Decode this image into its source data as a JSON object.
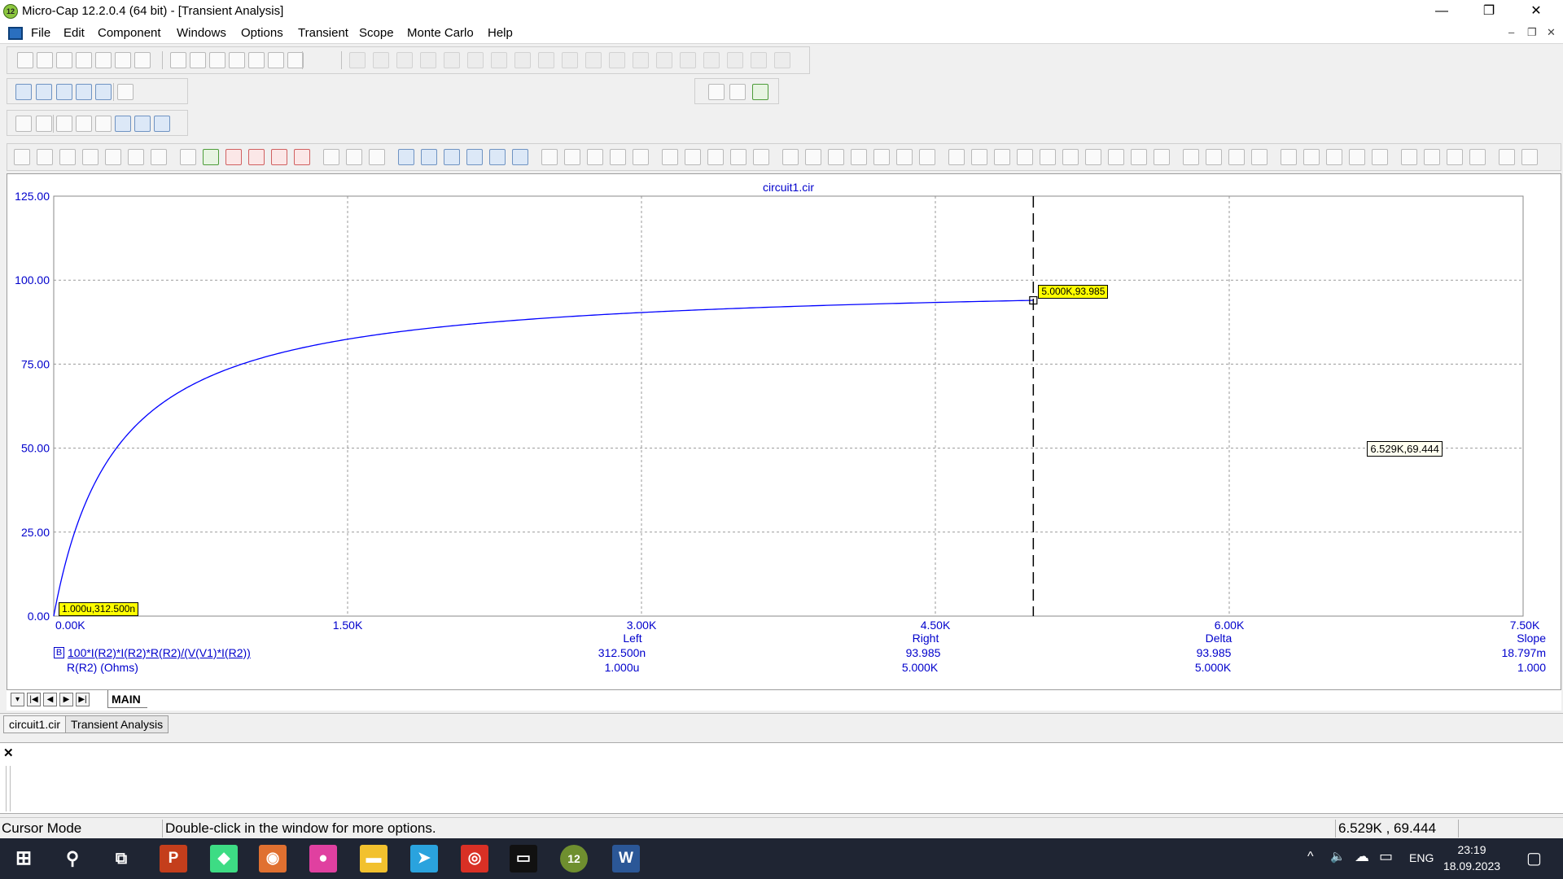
{
  "window": {
    "title": "Micro-Cap 12.2.0.4 (64 bit) - [Transient Analysis]",
    "app_badge": "12",
    "minimize_glyph": "—",
    "maximize_glyph": "❐",
    "close_glyph": "✕"
  },
  "menu": {
    "items": [
      "File",
      "Edit",
      "Component",
      "Windows",
      "Options",
      "Transient",
      "Scope",
      "Monte Carlo",
      "Help"
    ],
    "mdi_minimize": "–",
    "mdi_restore": "❐",
    "mdi_close": "✕"
  },
  "plot": {
    "title": "circuit1.cir",
    "x_axis": {
      "ticks": [
        "0.00K",
        "1.50K",
        "3.00K",
        "4.50K",
        "6.00K",
        "7.50K"
      ],
      "min": 0,
      "max": 7500
    },
    "y_axis": {
      "ticks": [
        "0.00",
        "25.00",
        "50.00",
        "75.00",
        "100.00",
        "125.00"
      ],
      "min": 0,
      "max": 125
    },
    "curve_color": "#0000ff",
    "text_color": "#0000cc",
    "cursor_x": 5000,
    "cursor_label_right": "5.000K,93.985",
    "cursor_label_left": "1.000u,312.500n",
    "mouse_label": "6.529K,69.444",
    "readout": {
      "expr_badge": "B",
      "y_expression": "100*I(R2)*I(R2)*R(R2)/(V(V1)*I(R2))",
      "x_expression": "R(R2) (Ohms)",
      "headers": [
        "Left",
        "Right",
        "Delta",
        "Slope"
      ],
      "y_values": [
        "312.500n",
        "93.985",
        "93.985",
        "18.797m"
      ],
      "x_values": [
        "1.000u",
        "5.000K",
        "5.000K",
        "1.000"
      ]
    }
  },
  "chart_data": {
    "type": "line",
    "title": "circuit1.cir",
    "xlabel": "R(R2) (Ohms)",
    "ylabel": "100*I(R2)*I(R2)*R(R2)/(V(V1)*I(R2))",
    "xlim": [
      0,
      7500
    ],
    "ylim": [
      0,
      125
    ],
    "grid": true,
    "series": [
      {
        "name": "100*I(R2)*I(R2)*R(R2)/(V(V1)*I(R2))",
        "x": [
          0,
          50,
          100,
          200,
          300,
          500,
          750,
          1000,
          1500,
          2000,
          2500,
          3000,
          3500,
          4000,
          4500,
          5000
        ],
        "y": [
          0,
          13.8,
          24.2,
          39.0,
          48.8,
          61.4,
          70.4,
          76.0,
          82.5,
          86.4,
          88.8,
          90.4,
          91.6,
          92.5,
          93.3,
          93.985
        ]
      }
    ]
  },
  "bottom_tabs": {
    "main": "MAIN",
    "nav": [
      "▾",
      "|◀",
      "◀",
      "▶",
      "▶|"
    ]
  },
  "doc_tabs": [
    "circuit1.cir",
    "Transient Analysis"
  ],
  "output": {
    "close_glyph": "✕"
  },
  "status": {
    "mode": "Cursor Mode",
    "hint": "Double-click in the window for more options.",
    "coords": "6.529K , 69.444"
  },
  "taskbar": {
    "search_glyph": "⚲",
    "taskview_glyph": "⧉",
    "apps": [
      {
        "name": "windows-start-icon",
        "glyph": "⊞",
        "color": "#1f2533"
      },
      {
        "name": "powerpoint-icon",
        "glyph": "P",
        "color": "#c43e1c"
      },
      {
        "name": "android-studio-icon",
        "glyph": "◆",
        "color": "#3ddc84"
      },
      {
        "name": "disc-app-icon",
        "glyph": "◉",
        "color": "#e07030"
      },
      {
        "name": "droplet-app-icon",
        "glyph": "●",
        "color": "#e040a0"
      },
      {
        "name": "file-explorer-icon",
        "glyph": "▬",
        "color": "#f2c12e"
      },
      {
        "name": "telegram-icon",
        "glyph": "➤",
        "color": "#2aa3de"
      },
      {
        "name": "chrome-icon",
        "glyph": "◎",
        "color": "#d93025"
      },
      {
        "name": "terminal-icon",
        "glyph": "▭",
        "color": "#111111"
      },
      {
        "name": "microcap-icon",
        "glyph": "12",
        "color": "#6f8f2f"
      },
      {
        "name": "word-icon",
        "glyph": "W",
        "color": "#2b5797"
      }
    ],
    "tray_chevron": "^",
    "volume_glyph": "🔈",
    "cloud_glyph": "☁",
    "battery_glyph": "▭",
    "language": "ENG",
    "time": "23:19",
    "date": "18.09.2023",
    "notification_glyph": "▢"
  }
}
